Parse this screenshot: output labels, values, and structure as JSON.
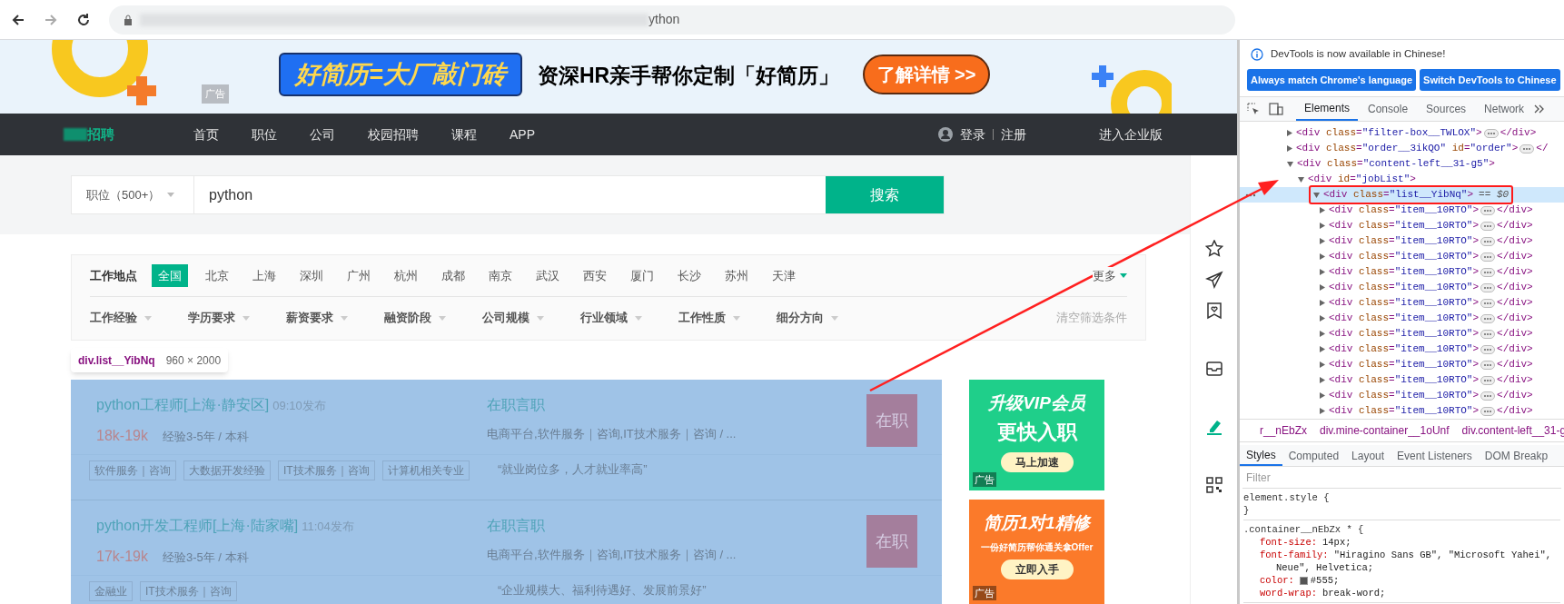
{
  "browser": {
    "url": "ython"
  },
  "banner": {
    "headline": "好简历=大厂敲门砖",
    "tagline": "资深HR亲手帮你定制「好简历」",
    "button": "了解详情 >>",
    "ad_label": "广告"
  },
  "nav": {
    "logo": "招聘",
    "items": [
      "首页",
      "职位",
      "公司",
      "校园招聘",
      "课程",
      "APP"
    ],
    "login": "登录",
    "register": "注册",
    "enterprise": "进入企业版"
  },
  "search": {
    "category": "职位（500+）",
    "value": "python",
    "button": "搜索"
  },
  "filters": {
    "location_label": "工作地点",
    "cities": [
      {
        "label": "全国",
        "selected": true
      },
      {
        "label": "北京",
        "selected": false
      },
      {
        "label": "上海",
        "selected": false
      },
      {
        "label": "深圳",
        "selected": false
      },
      {
        "label": "广州",
        "selected": false
      },
      {
        "label": "杭州",
        "selected": false
      },
      {
        "label": "成都",
        "selected": false
      },
      {
        "label": "南京",
        "selected": false
      },
      {
        "label": "武汉",
        "selected": false
      },
      {
        "label": "西安",
        "selected": false
      },
      {
        "label": "厦门",
        "selected": false
      },
      {
        "label": "长沙",
        "selected": false
      },
      {
        "label": "苏州",
        "selected": false
      },
      {
        "label": "天津",
        "selected": false
      }
    ],
    "more": "更多",
    "dropdowns": [
      "工作经验",
      "学历要求",
      "薪资要求",
      "融资阶段",
      "公司规模",
      "行业领域",
      "工作性质",
      "细分方向"
    ],
    "clear": "清空筛选条件"
  },
  "inspector_tooltip": {
    "selector": "div.list__YibNq",
    "size": "960 × 2000"
  },
  "jobs": [
    {
      "title": "python工程师[上海·静安区]",
      "time": "09:10发布",
      "salary": "18k-19k",
      "requirement": "经验3-5年 / 本科",
      "company": "在职言职",
      "company_info": "电商平台,软件服务｜咨询,IT技术服务｜咨询 / ...",
      "tags": [
        "软件服务｜咨询",
        "大数据开发经验",
        "IT技术服务｜咨询",
        "计算机相关专业"
      ],
      "quote": "“就业岗位多，人才就业率高”",
      "badge": "在职"
    },
    {
      "title": "python开发工程师[上海·陆家嘴]",
      "time": "11:04发布",
      "salary": "17k-19k",
      "requirement": "经验3-5年 / 本科",
      "company": "在职言职",
      "company_info": "电商平台,软件服务｜咨询,IT技术服务｜咨询 / ...",
      "tags": [
        "金融业",
        "IT技术服务｜咨询"
      ],
      "quote": "“企业规模大、福利待遇好、发展前景好”",
      "badge": "在职"
    }
  ],
  "ads": [
    {
      "headline": "升级VIP会员",
      "subline": "更快入职",
      "button": "马上加速",
      "label": "广告",
      "color": "#1fcf8a"
    },
    {
      "headline": "简历1对1精修",
      "subline": "一份好简历帮你通关拿Offer",
      "button": "立即入手",
      "label": "广告",
      "color": "#fb7a2a"
    }
  ],
  "devtools": {
    "notice": "DevTools is now available in Chinese!",
    "language_buttons": [
      "Always match Chrome's language",
      "Switch DevTools to Chinese"
    ],
    "tabs": [
      {
        "label": "Elements",
        "selected": true
      },
      {
        "label": "Console",
        "selected": false
      },
      {
        "label": "Sources",
        "selected": false
      },
      {
        "label": "Network",
        "selected": false
      }
    ],
    "dom_tree": [
      {
        "tag": "<div class=\"filter-box__TWLOX\">",
        "close": "</div>",
        "expanded": false,
        "selected": false
      },
      {
        "tag": "<div class=\"order__3ikQO\" id=\"order\">",
        "close": "</",
        "expanded": false,
        "selected": false
      },
      {
        "tag": "<div class=\"content-left__31-g5\">",
        "expanded": true,
        "selected": false,
        "children": [
          {
            "tag": "<div id=\"jobList\">",
            "expanded": true,
            "selected": false,
            "children": [
              {
                "tag": "<div class=\"list__YibNq\">",
                "suffix": "== $0",
                "expanded": true,
                "selected": true,
                "children": [
                  {
                    "tag": "<div class=\"item__10RTO\">",
                    "close": "</div>",
                    "expanded": false,
                    "selected": false
                  },
                  {
                    "tag": "<div class=\"item__10RTO\">",
                    "close": "</div>",
                    "expanded": false,
                    "selected": false
                  },
                  {
                    "tag": "<div class=\"item__10RTO\">",
                    "close": "</div>",
                    "expanded": false,
                    "selected": false
                  },
                  {
                    "tag": "<div class=\"item__10RTO\">",
                    "close": "</div>",
                    "expanded": false,
                    "selected": false
                  },
                  {
                    "tag": "<div class=\"item__10RTO\">",
                    "close": "</div>",
                    "expanded": false,
                    "selected": false
                  },
                  {
                    "tag": "<div class=\"item__10RTO\">",
                    "close": "</div>",
                    "expanded": false,
                    "selected": false
                  },
                  {
                    "tag": "<div class=\"item__10RTO\">",
                    "close": "</div>",
                    "expanded": false,
                    "selected": false
                  },
                  {
                    "tag": "<div class=\"item__10RTO\">",
                    "close": "</div>",
                    "expanded": false,
                    "selected": false
                  },
                  {
                    "tag": "<div class=\"item__10RTO\">",
                    "close": "</div>",
                    "expanded": false,
                    "selected": false
                  },
                  {
                    "tag": "<div class=\"item__10RTO\">",
                    "close": "</div>",
                    "expanded": false,
                    "selected": false
                  },
                  {
                    "tag": "<div class=\"item__10RTO\">",
                    "close": "</div>",
                    "expanded": false,
                    "selected": false
                  },
                  {
                    "tag": "<div class=\"item__10RTO\">",
                    "close": "</div>",
                    "expanded": false,
                    "selected": false
                  },
                  {
                    "tag": "<div class=\"item__10RTO\">",
                    "close": "</div>",
                    "expanded": false,
                    "selected": false
                  },
                  {
                    "tag": "<div class=\"item__10RTO\">",
                    "close": "</div>",
                    "expanded": false,
                    "selected": false
                  }
                ]
              }
            ]
          }
        ]
      }
    ],
    "breadcrumbs": [
      "r__nEbZx",
      "div.mine-container__1oUnf",
      "div.content-left__31-g"
    ],
    "style_tabs": [
      {
        "label": "Styles",
        "selected": true
      },
      {
        "label": "Computed",
        "selected": false
      },
      {
        "label": "Layout",
        "selected": false
      },
      {
        "label": "Event Listeners",
        "selected": false
      },
      {
        "label": "DOM Breakp",
        "selected": false
      }
    ],
    "filter_placeholder": "Filter",
    "rules": [
      {
        "selector": "element.style {",
        "close": "}"
      },
      {
        "selector": ".container__nEbZx * {",
        "properties": [
          {
            "name": "font-size:",
            "value": "14px;"
          },
          {
            "name": "font-family:",
            "value": "\"Hiragino Sans GB\", \"Microsoft Yahei\",",
            "continuation": "Neue\", Helvetica;"
          },
          {
            "name": "color:",
            "value": "#555;",
            "color": "#555555"
          },
          {
            "name": "word-wrap:",
            "value": "break-word;"
          }
        ]
      }
    ]
  }
}
